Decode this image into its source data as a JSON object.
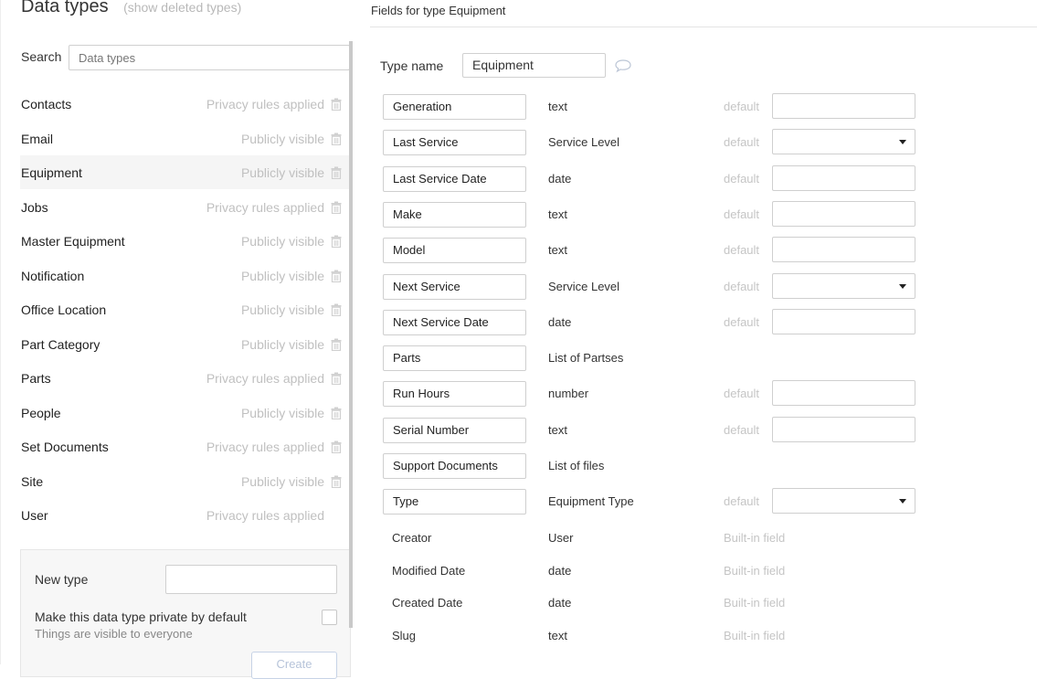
{
  "data_types": {
    "title": "Data types",
    "show_deleted": "(show deleted types)",
    "search_label": "Search",
    "search_placeholder": "Data types",
    "items": [
      {
        "name": "Contacts",
        "status": "Privacy rules applied",
        "trash": true
      },
      {
        "name": "Email",
        "status": "Publicly visible",
        "trash": true
      },
      {
        "name": "Equipment",
        "status": "Publicly visible",
        "trash": true,
        "selected": true
      },
      {
        "name": "Jobs",
        "status": "Privacy rules applied",
        "trash": true
      },
      {
        "name": "Master Equipment",
        "status": "Publicly visible",
        "trash": true
      },
      {
        "name": "Notification",
        "status": "Publicly visible",
        "trash": true
      },
      {
        "name": "Office Location",
        "status": "Publicly visible",
        "trash": true
      },
      {
        "name": "Part Category",
        "status": "Publicly visible",
        "trash": true
      },
      {
        "name": "Parts",
        "status": "Privacy rules applied",
        "trash": true
      },
      {
        "name": "People",
        "status": "Publicly visible",
        "trash": true
      },
      {
        "name": "Set Documents",
        "status": "Privacy rules applied",
        "trash": true
      },
      {
        "name": "Site",
        "status": "Publicly visible",
        "trash": true
      },
      {
        "name": "User",
        "status": "Privacy rules applied",
        "trash": false
      }
    ],
    "new_type": {
      "label": "New type",
      "private_label": "Make this data type private by default",
      "sub_label": "Things are visible to everyone",
      "create_label": "Create"
    }
  },
  "fields_panel": {
    "title": "Fields for type Equipment",
    "type_name_label": "Type name",
    "type_name_value": "Equipment",
    "default_label": "default",
    "builtin_label": "Built-in field",
    "fields": [
      {
        "name": "Generation",
        "type": "text",
        "default": "input"
      },
      {
        "name": "Last Service",
        "type": "Service Level",
        "default": "select"
      },
      {
        "name": "Last Service Date",
        "type": "date",
        "default": "input"
      },
      {
        "name": "Make",
        "type": "text",
        "default": "input"
      },
      {
        "name": "Model",
        "type": "text",
        "default": "input"
      },
      {
        "name": "Next Service",
        "type": "Service Level",
        "default": "select"
      },
      {
        "name": "Next Service Date",
        "type": "date",
        "default": "input"
      },
      {
        "name": "Parts",
        "type": "List of Partses",
        "default": "none"
      },
      {
        "name": "Run Hours",
        "type": "number",
        "default": "input"
      },
      {
        "name": "Serial Number",
        "type": "text",
        "default": "input"
      },
      {
        "name": "Support Documents",
        "type": "List of files",
        "default": "none"
      },
      {
        "name": "Type",
        "type": "Equipment Type",
        "default": "select"
      }
    ],
    "builtin_fields": [
      {
        "name": "Creator",
        "type": "User"
      },
      {
        "name": "Modified Date",
        "type": "date"
      },
      {
        "name": "Created Date",
        "type": "date"
      },
      {
        "name": "Slug",
        "type": "text"
      }
    ]
  },
  "icons": {
    "trash": "trash-icon",
    "comment": "comment-icon",
    "dropdown": "chevron-down-icon"
  }
}
